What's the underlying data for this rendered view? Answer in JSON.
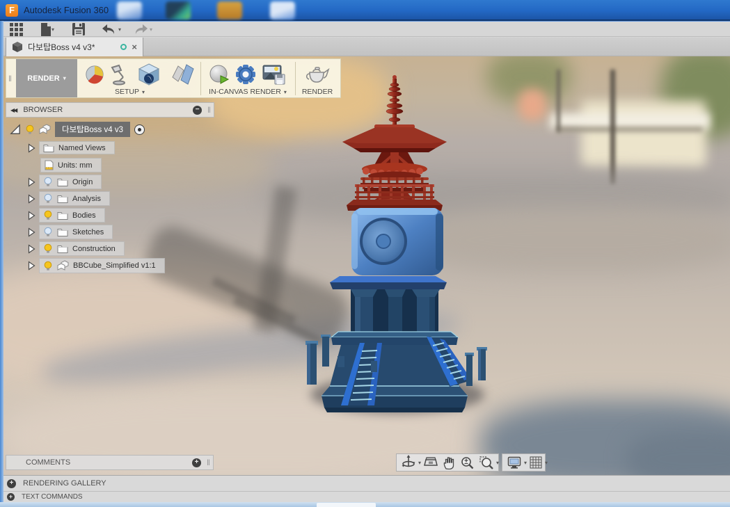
{
  "glyphs": {
    "logo_f": "F",
    "caret": "▾",
    "plus": "+",
    "minus": "−",
    "grip": "‖",
    "chevrons_left": "◀◀",
    "close": "×",
    "plusminus": "±"
  },
  "titlebar": {
    "app_title": "Autodesk Fusion 360"
  },
  "document_tab": {
    "title": "다보탑Boss v4 v3*"
  },
  "ribbon": {
    "workspace_label": "RENDER",
    "groups": {
      "setup": "SETUP",
      "in_canvas": "IN-CANVAS RENDER",
      "render": "RENDER"
    }
  },
  "browser": {
    "header_label": "BROWSER",
    "root": {
      "label": "다보탑Boss v4 v3"
    },
    "items": [
      {
        "label": "Named Views",
        "icon": "folder",
        "bulb": null
      },
      {
        "label": "Units: mm",
        "icon": "document",
        "bulb": null
      },
      {
        "label": "Origin",
        "icon": "folder",
        "bulb": "off"
      },
      {
        "label": "Analysis",
        "icon": "folder",
        "bulb": "off"
      },
      {
        "label": "Bodies",
        "icon": "folder",
        "bulb": "on"
      },
      {
        "label": "Sketches",
        "icon": "folder",
        "bulb": "off"
      },
      {
        "label": "Construction",
        "icon": "folder",
        "bulb": "on"
      },
      {
        "label": "BBCube_Simplified v1:1",
        "icon": "component",
        "bulb": "on"
      }
    ]
  },
  "comments_panel": {
    "label": "COMMENTS"
  },
  "bottom_panels": {
    "rendering_gallery": "RENDERING GALLERY",
    "text_commands": "TEXT COMMANDS"
  },
  "icons": {
    "quick_toolbar": [
      "app-grid",
      "file-new",
      "save",
      "undo",
      "redo"
    ],
    "ribbon_setup": [
      "appearance-pie",
      "scene-settings-lamp",
      "render-environment-cube",
      "decal"
    ],
    "ribbon_in_canvas": [
      "in-canvas-render-sphere",
      "render-settings-gear",
      "capture-image"
    ],
    "ribbon_render": [
      "render-teapot"
    ],
    "navigation": [
      "orbit",
      "look-at",
      "pan",
      "zoom",
      "zoom-window",
      "display-settings",
      "grid-display"
    ],
    "tab": [
      "document-cube",
      "sync-status-circle",
      "close"
    ]
  },
  "colors": {
    "titlebar_blue": "#2368c4",
    "workspace_button_gray": "#9c9c9c",
    "bulb_on": "#f6c51e",
    "bulb_off": "#dce9f8",
    "tab_sync_teal": "#3ab5a0",
    "model_red": "#8e2a1d",
    "model_cube_blue": "#4d80c2",
    "model_base_navy": "#27496c"
  }
}
